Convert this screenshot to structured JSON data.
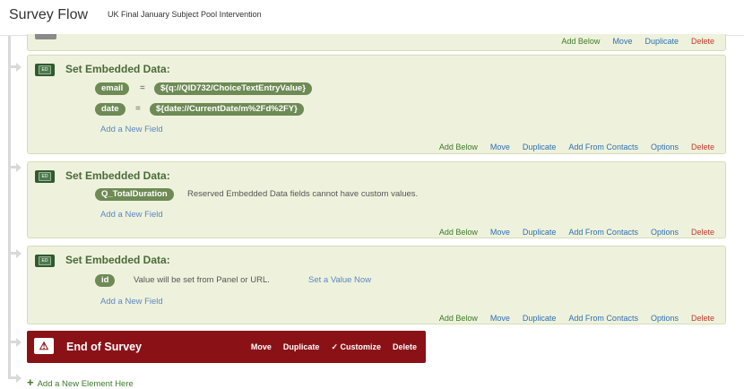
{
  "header": {
    "title": "Survey Flow",
    "subtitle": "UK Final January Subject Pool Intervention"
  },
  "top_block": {
    "actions": [
      "Add Below",
      "Move",
      "Duplicate",
      "Delete"
    ]
  },
  "blocks": [
    {
      "badge": "ED",
      "title": "Set Embedded Data:",
      "fields": [
        {
          "name": "email",
          "eq": "=",
          "value": "${q://QID732/ChoiceTextEntryValue}"
        },
        {
          "name": "date",
          "eq": "=",
          "value": "${date://CurrentDate/m%2Fd%2FY}"
        }
      ],
      "add_field": "Add a New Field",
      "actions": [
        "Add Below",
        "Move",
        "Duplicate",
        "Add From Contacts",
        "Options",
        "Delete"
      ]
    },
    {
      "badge": "ED",
      "title": "Set Embedded Data:",
      "field_name": "Q_TotalDuration",
      "note": "Reserved Embedded Data fields cannot have custom values.",
      "add_field": "Add a New Field",
      "actions": [
        "Add Below",
        "Move",
        "Duplicate",
        "Add From Contacts",
        "Options",
        "Delete"
      ]
    },
    {
      "badge": "ED",
      "title": "Set Embedded Data:",
      "field_name": "id",
      "note": "Value will be set from Panel or URL.",
      "set_value": "Set a Value Now",
      "add_field": "Add a New Field",
      "actions": [
        "Add Below",
        "Move",
        "Duplicate",
        "Add From Contacts",
        "Options",
        "Delete"
      ]
    }
  ],
  "end_of_survey": {
    "icon": "warning-icon",
    "title": "End of Survey",
    "actions": [
      "Move",
      "Duplicate",
      "✓ Customize",
      "Delete"
    ]
  },
  "add_element": {
    "label": "Add a New Element Here"
  },
  "colors": {
    "block_bg": "#eef2dc",
    "pill_bg": "#6e8a55",
    "end_bg": "#8a1217",
    "link_blue": "#5b87c5"
  }
}
